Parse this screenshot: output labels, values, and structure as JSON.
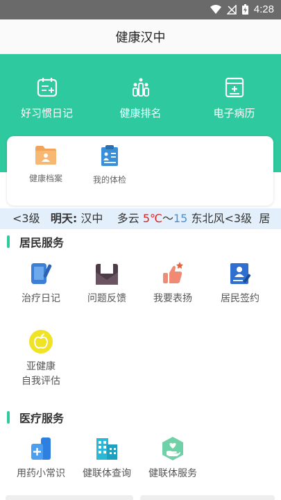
{
  "status_bar": {
    "time": "4:28"
  },
  "title": "健康汉中",
  "top_nav": [
    {
      "label": "好习惯日记",
      "icon": "diary-icon"
    },
    {
      "label": "健康排名",
      "icon": "ranking-icon"
    },
    {
      "label": "电子病历",
      "icon": "medical-record-icon"
    }
  ],
  "card_items": [
    {
      "label": "健康档案",
      "icon": "folder-icon"
    },
    {
      "label": "我的体检",
      "icon": "clipboard-icon"
    }
  ],
  "weather": {
    "prefix": "<3级",
    "tomorrow_label": "明天:",
    "city": "汉中",
    "condition": "多云",
    "temp_high": "5℃",
    "tilde": "～",
    "temp_low": "15",
    "wind": "东北风<3级",
    "tail": "居"
  },
  "resident_section": {
    "title": "居民服务",
    "items": [
      {
        "label": "治疗日记",
        "icon": "tablet-pen-icon"
      },
      {
        "label": "问题反馈",
        "icon": "mail-open-icon"
      },
      {
        "label": "我要表扬",
        "icon": "thumbs-up-icon"
      },
      {
        "label": "居民签约",
        "icon": "contract-sign-icon"
      },
      {
        "label_line1": "亚健康",
        "label_line2": "自我评估",
        "icon": "apple-icon"
      }
    ]
  },
  "medical_section": {
    "title": "医疗服务",
    "items": [
      {
        "label": "用药小常识",
        "icon": "medicine-icon"
      },
      {
        "label": "健联体查询",
        "icon": "building-icon"
      },
      {
        "label": "健联体服务",
        "icon": "hand-heart-icon"
      }
    ]
  },
  "colors": {
    "accent": "#2ec99e",
    "weather_bg": "#e3f0fb",
    "temp_red": "#e02020",
    "temp_blue": "#4a90d9"
  }
}
